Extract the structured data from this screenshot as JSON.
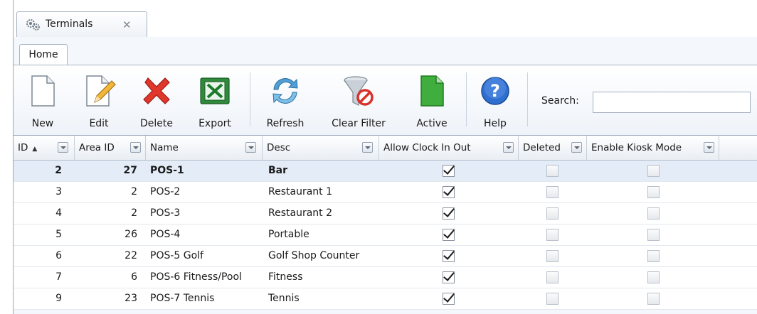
{
  "document_tab": {
    "label": "Terminals",
    "close_glyph": "✕",
    "icon": "gears-icon"
  },
  "ribbon_tab": {
    "label": "Home"
  },
  "toolbar": {
    "new_label": "New",
    "edit_label": "Edit",
    "delete_label": "Delete",
    "export_label": "Export",
    "refresh_label": "Refresh",
    "clear_filter_label": "Clear Filter",
    "active_label": "Active",
    "help_label": "Help"
  },
  "search": {
    "label": "Search:",
    "value": "",
    "placeholder": ""
  },
  "grid": {
    "columns": {
      "id": "ID",
      "area_id": "Area ID",
      "name": "Name",
      "desc": "Desc",
      "allow_clock": "Allow Clock In Out",
      "deleted": "Deleted",
      "kiosk": "Enable Kiosk Mode"
    },
    "sort_indicator": "▲",
    "rows": [
      {
        "id": "2",
        "area_id": "27",
        "name": "POS-1",
        "desc": "Bar",
        "allow_clock": true,
        "deleted": false,
        "kiosk": false,
        "selected": true
      },
      {
        "id": "3",
        "area_id": "2",
        "name": "POS-2",
        "desc": "Restaurant 1",
        "allow_clock": true,
        "deleted": false,
        "kiosk": false
      },
      {
        "id": "4",
        "area_id": "2",
        "name": "POS-3",
        "desc": "Restaurant 2",
        "allow_clock": true,
        "deleted": false,
        "kiosk": false
      },
      {
        "id": "5",
        "area_id": "26",
        "name": "POS-4",
        "desc": "Portable",
        "allow_clock": true,
        "deleted": false,
        "kiosk": false
      },
      {
        "id": "6",
        "area_id": "22",
        "name": "POS-5 Golf",
        "desc": "Golf Shop Counter",
        "allow_clock": true,
        "deleted": false,
        "kiosk": false
      },
      {
        "id": "7",
        "area_id": "6",
        "name": "POS-6 Fitness/Pool",
        "desc": "Fitness",
        "allow_clock": true,
        "deleted": false,
        "kiosk": false
      },
      {
        "id": "9",
        "area_id": "23",
        "name": "POS-7 Tennis",
        "desc": "Tennis",
        "allow_clock": true,
        "deleted": false,
        "kiosk": false
      }
    ]
  }
}
